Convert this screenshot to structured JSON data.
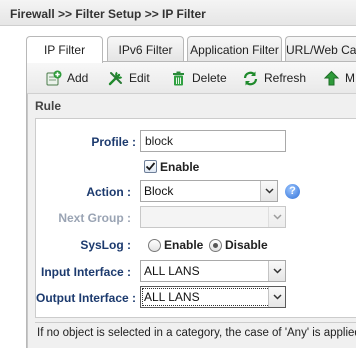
{
  "breadcrumb": "Firewall >> Filter Setup >> IP Filter",
  "tabs": [
    {
      "label": "IP Filter",
      "active": true
    },
    {
      "label": "IPv6 Filter",
      "active": false
    },
    {
      "label": "Application Filter",
      "active": false
    },
    {
      "label": "URL/Web Ca",
      "active": false
    }
  ],
  "toolbar": {
    "add": "Add",
    "edit": "Edit",
    "delete": "Delete",
    "refresh": "Refresh",
    "more": "M"
  },
  "rule": {
    "header": "Rule",
    "profile_label": "Profile :",
    "profile_value": "block",
    "enable_label": "Enable",
    "enable_checked": true,
    "action_label": "Action :",
    "action_value": "Block",
    "next_group_label": "Next Group :",
    "next_group_value": "",
    "syslog_label": "SysLog :",
    "syslog_enable": "Enable",
    "syslog_disable": "Disable",
    "syslog_selected": "Disable",
    "input_interface_label": "Input Interface :",
    "input_interface_value": "ALL LANS",
    "output_interface_label": "Output Interface :",
    "output_interface_value": "ALL LANS",
    "help_icon": "question-mark-icon"
  },
  "note": "If no object is selected in a category, the case of 'Any' is applied"
}
